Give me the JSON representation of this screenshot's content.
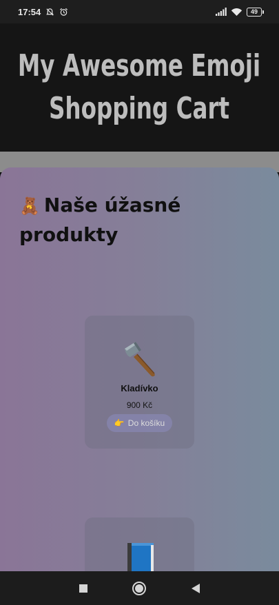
{
  "status_bar": {
    "time": "17:54",
    "battery": "49",
    "icons": [
      "mute-icon",
      "alarm-icon",
      "signal-icon",
      "wifi-icon",
      "battery-icon"
    ]
  },
  "header": {
    "title_line1": "My Awesome Emoji",
    "title_line2": "Shopping Cart"
  },
  "products_section": {
    "heading_emoji": "🧸",
    "heading": "Naše úžasné produkty"
  },
  "products": [
    {
      "emoji": "hammer-icon",
      "name": "Kladívko",
      "price": "900 Kč",
      "button_emoji": "👉",
      "button_label": "Do košíku"
    },
    {
      "emoji": "book-icon"
    }
  ],
  "nav_bar": {
    "icons": [
      "recents-square-icon",
      "home-circle-icon",
      "back-triangle-icon"
    ]
  },
  "colors": {
    "header_bg": "#151515",
    "title_text": "#bdbdbd",
    "card_gradient_start": "#8a7597",
    "card_gradient_end": "#7a8b9d"
  }
}
